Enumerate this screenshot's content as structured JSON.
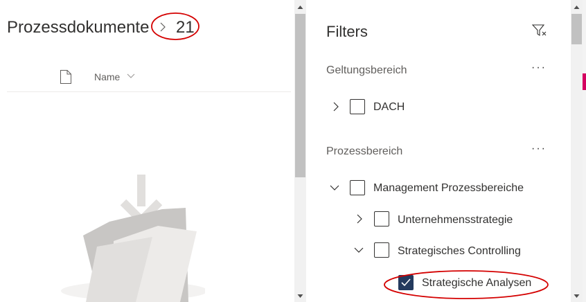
{
  "library": {
    "title": "Prozessdokumente",
    "count": "21",
    "column_name": "Name"
  },
  "filters": {
    "title": "Filters",
    "sections": [
      {
        "label": "Geltungsbereich",
        "more": "···",
        "items": [
          {
            "label": "DACH",
            "checked": false,
            "expanded": false
          }
        ]
      },
      {
        "label": "Prozessbereich",
        "more": "···",
        "items": [
          {
            "label": "Management Prozessbereiche",
            "checked": false,
            "expanded": true
          },
          {
            "label": "Unternehmensstrategie",
            "checked": false,
            "expanded": false
          },
          {
            "label": "Strategisches Controlling",
            "checked": false,
            "expanded": true
          },
          {
            "label": "Strategische Analysen",
            "checked": true
          }
        ]
      }
    ]
  },
  "colors": {
    "checked_fill": "#243a5e",
    "annotation_ring": "#d40000",
    "accent_mark": "#d40060"
  }
}
